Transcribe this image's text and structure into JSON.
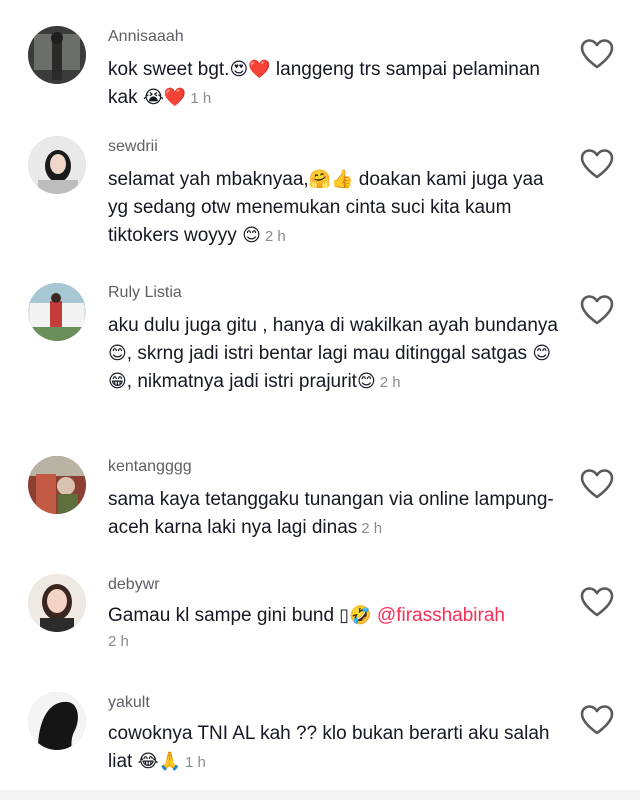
{
  "comments": [
    {
      "username": "Annisaaah",
      "text_parts": [
        "kok sweet bgt.",
        "😍❤️",
        " langgeng trs sampai pelaminan kak ",
        "😭❤️"
      ],
      "time": "1 h"
    },
    {
      "username": "sewdrii",
      "text_parts": [
        "selamat yah mbaknyaa,",
        "🤗👍",
        " doakan kami juga yaa yg sedang otw menemukan cinta suci kita kaum tiktokers woyyy ",
        "😊"
      ],
      "time": "2 h"
    },
    {
      "username": "Ruly Listia",
      "text_parts": [
        "aku dulu juga gitu , hanya di wakilkan ayah bundanya ",
        "😊",
        ", skrng jadi istri bentar lagi mau ditinggal satgas ",
        "😊😁",
        ", nikmatnya jadi istri prajurit",
        "😊"
      ],
      "time": "2 h"
    },
    {
      "username": "kentangggg",
      "text": "sama kaya tetanggaku tunangan via online lampung-aceh karna laki nya lagi dinas",
      "time": "2 h"
    },
    {
      "username": "debywr",
      "text_before": "Gamau kl sampe gini bund ",
      "emoji": "▯🤣",
      "mention": "@firasshabirah",
      "time": "2 h"
    },
    {
      "username": "yakult",
      "text_parts": [
        "cowoknya TNI AL kah ?? klo bukan berarti aku salah liat ",
        "😂🙏"
      ],
      "time": "1 h"
    }
  ],
  "icons": {
    "like": "heart-outline-icon"
  },
  "colors": {
    "mention": "#fe2c55",
    "username": "#5e5e66",
    "time": "#8a8b91"
  }
}
